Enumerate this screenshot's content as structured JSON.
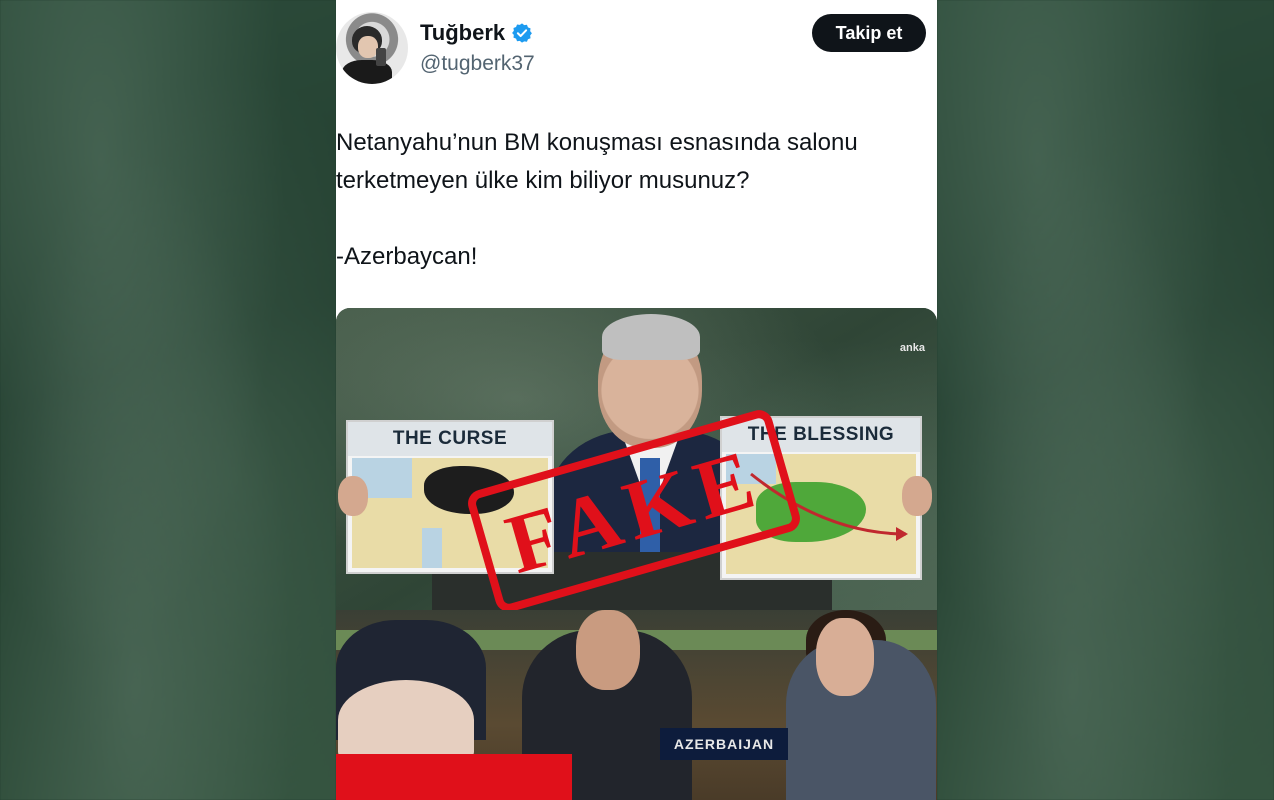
{
  "tweet": {
    "author_name": "Tuğberk",
    "author_handle": "@tugberk37",
    "follow_label": "Takip et",
    "text_line_1": "Netanyahu’nun BM konuşması esnasında salonu",
    "text_line_2": "terketmeyen ülke kim biliyor musunuz?",
    "text_line_3": "-Azerbaycan!"
  },
  "media": {
    "watermark": "anka",
    "sign_left_title": "THE CURSE",
    "sign_right_title": "THE BLESSING",
    "stamp_text": "FAKE",
    "nameplate": "AZERBAIJAN"
  },
  "colors": {
    "verified_badge": "#1d9bf0",
    "stamp": "#e0101a",
    "follow_button": "#0f1419"
  },
  "icons": [
    "verified-badge-icon"
  ]
}
